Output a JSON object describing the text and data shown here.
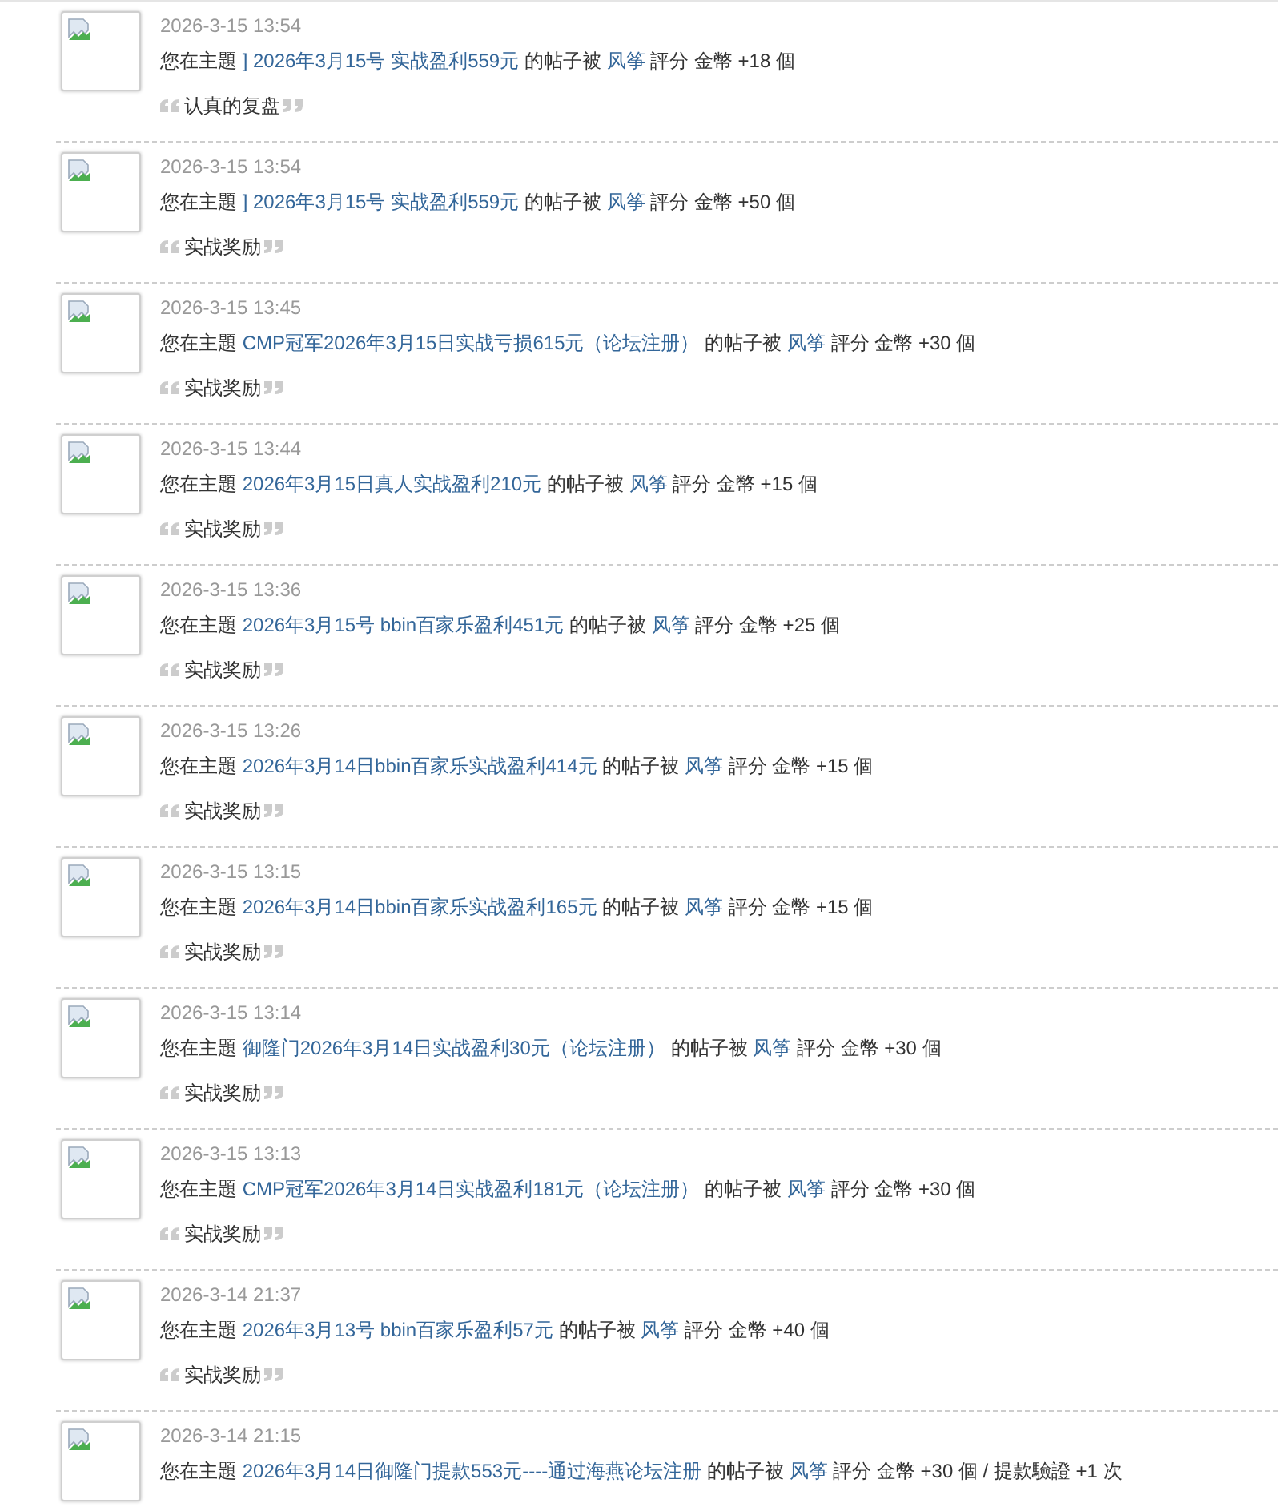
{
  "notices": [
    {
      "time": "2026-3-15 13:54",
      "prefix": "您在主題",
      "topic": "] 2026年3月15号 实战盈利559元",
      "middle": "的帖子被",
      "user": "风筝",
      "suffix": "評分 金幣 +18 個",
      "reason": "认真的复盘"
    },
    {
      "time": "2026-3-15 13:54",
      "prefix": "您在主題",
      "topic": "] 2026年3月15号 实战盈利559元",
      "middle": "的帖子被",
      "user": "风筝",
      "suffix": "評分 金幣 +50 個",
      "reason": "实战奖励"
    },
    {
      "time": "2026-3-15 13:45",
      "prefix": "您在主題",
      "topic": "CMP冠军2026年3月15日实战亏损615元（论坛注册）",
      "middle": "的帖子被",
      "user": "风筝",
      "suffix": "評分 金幣 +30 個",
      "reason": "实战奖励"
    },
    {
      "time": "2026-3-15 13:44",
      "prefix": "您在主題",
      "topic": "2026年3月15日真人实战盈利210元",
      "middle": "的帖子被",
      "user": "风筝",
      "suffix": "評分 金幣 +15 個",
      "reason": "实战奖励"
    },
    {
      "time": "2026-3-15 13:36",
      "prefix": "您在主題",
      "topic": "2026年3月15号 bbin百家乐盈利451元",
      "middle": "的帖子被",
      "user": "风筝",
      "suffix": "評分 金幣 +25 個",
      "reason": "实战奖励"
    },
    {
      "time": "2026-3-15 13:26",
      "prefix": "您在主題",
      "topic": "2026年3月14日bbin百家乐实战盈利414元",
      "middle": "的帖子被",
      "user": "风筝",
      "suffix": "評分 金幣 +15 個",
      "reason": "实战奖励"
    },
    {
      "time": "2026-3-15 13:15",
      "prefix": "您在主題",
      "topic": "2026年3月14日bbin百家乐实战盈利165元",
      "middle": "的帖子被",
      "user": "风筝",
      "suffix": "評分 金幣 +15 個",
      "reason": "实战奖励"
    },
    {
      "time": "2026-3-15 13:14",
      "prefix": "您在主題",
      "topic": "御隆门2026年3月14日实战盈利30元（论坛注册）",
      "middle": "的帖子被",
      "user": "风筝",
      "suffix": "評分 金幣 +30 個",
      "reason": "实战奖励"
    },
    {
      "time": "2026-3-15 13:13",
      "prefix": "您在主題",
      "topic": "CMP冠军2026年3月14日实战盈利181元（论坛注册）",
      "middle": "的帖子被",
      "user": "风筝",
      "suffix": "評分 金幣 +30 個",
      "reason": "实战奖励"
    },
    {
      "time": "2026-3-14 21:37",
      "prefix": "您在主題",
      "topic": "2026年3月13号 bbin百家乐盈利57元",
      "middle": "的帖子被",
      "user": "风筝",
      "suffix": "評分 金幣 +40 個",
      "reason": "实战奖励"
    },
    {
      "time": "2026-3-14 21:15",
      "prefix": "您在主題",
      "topic": "2026年3月14日御隆门提款553元----通过海燕论坛注册",
      "middle": "的帖子被",
      "user": "风筝",
      "suffix": "評分 金幣 +30 個 / 提款驗證 +1 次"
    }
  ]
}
